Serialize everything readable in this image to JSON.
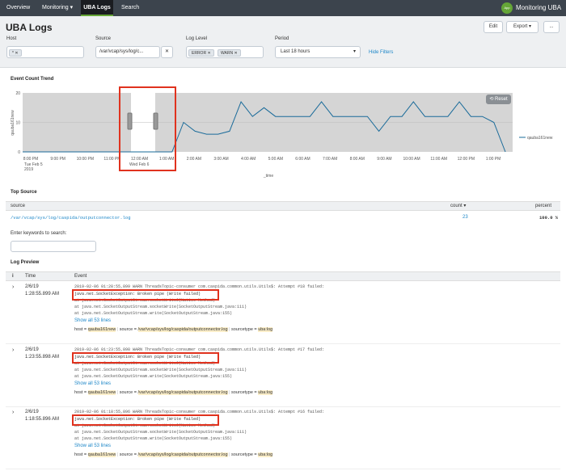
{
  "nav": {
    "tabs": [
      "Overview",
      "Monitoring ▾",
      "UBA Logs",
      "Search"
    ],
    "app_logo_text": "App",
    "app_title": "Monitoring UBA"
  },
  "page": {
    "title": "UBA Logs",
    "buttons": {
      "edit": "Edit",
      "export": "Export ▾",
      "more": "..."
    }
  },
  "filters": {
    "host": {
      "label": "Host",
      "token": "*"
    },
    "source": {
      "label": "Source",
      "value": "/var/vcap/sys/log/c..."
    },
    "loglevel": {
      "label": "Log Level",
      "tokens": [
        "ERROR",
        "WARN"
      ]
    },
    "period": {
      "label": "Period",
      "value": "Last 18 hours"
    },
    "hide_filters": "Hide Filters"
  },
  "trend": {
    "title": "Event Count Trend",
    "reset_label": "⟲ Reset",
    "legend": "qauba161new",
    "ylabel": "qauba161new",
    "xlabel": "_time",
    "date_labels": {
      "left": "Tue Feb 5",
      "left_year": "2019",
      "mid": "Wed Feb 6"
    }
  },
  "chart_data": {
    "type": "line",
    "series": [
      {
        "name": "qauba161new",
        "values": [
          0,
          0,
          0,
          0,
          0,
          0,
          0,
          0,
          0,
          0,
          0,
          0,
          0,
          0,
          10,
          7,
          6,
          6,
          7,
          17,
          12,
          15,
          12,
          12,
          12,
          12,
          17,
          12,
          12,
          12,
          12,
          7,
          12,
          12,
          17,
          12,
          12,
          12,
          17,
          12,
          12,
          10,
          0
        ]
      }
    ],
    "x_ticks": [
      "8:00 PM",
      "9:00 PM",
      "10:00 PM",
      "11:00 PM",
      "12:00 AM",
      "1:00 AM",
      "2:00 AM",
      "3:00 AM",
      "4:00 AM",
      "5:00 AM",
      "6:00 AM",
      "7:00 AM",
      "8:00 AM",
      "9:00 AM",
      "10:00 AM",
      "11:00 AM",
      "12:00 PM",
      "1:00 PM"
    ],
    "y_ticks": [
      "20",
      "10",
      "0"
    ],
    "ylim": [
      0,
      20
    ],
    "xlabel": "_time",
    "ylabel": "qauba161new",
    "grid": true,
    "legend_position": "right"
  },
  "top_source": {
    "title": "Top Source",
    "columns": {
      "source": "source",
      "count": "count",
      "percent": "percent"
    },
    "row": {
      "source": "/var/vcap/sys/log/caspida/outputconnector.log",
      "count": "23",
      "percent": "100.0 %"
    }
  },
  "keywords": {
    "label": "Enter keywords to search:"
  },
  "log_preview": {
    "title": "Log Preview",
    "columns": {
      "info": "i",
      "time": "Time",
      "event": "Event"
    },
    "events": [
      {
        "date": "2/6/19",
        "time": "1:28:55.899 AM",
        "line1": "2019-02-06 01:28:55,899 WARN ThreadsTopic-consumer com.caspida.common.utils.Utils$: Attempt #18 failed:",
        "exception": "java.net.SocketException: Broken pipe (Write failed)",
        "stack": [
          "        at java.net.SocketOutputStream.socketWrite0(Native Method)",
          "        at java.net.SocketOutputStream.socketWrite(SocketOutputStream.java:111)",
          "        at java.net.SocketOutputStream.write(SocketOutputStream.java:155)"
        ],
        "show_all": "Show all 53 lines",
        "host": "qauba161new",
        "source": "/var/vcap/sys/log/caspida/outputconnector.log",
        "sourcetype": "uba:log"
      },
      {
        "date": "2/6/19",
        "time": "1:23:55.898 AM",
        "line1": "2019-02-06 01:23:55,898 WARN ThreadsTopic-consumer com.caspida.common.utils.Utils$: Attempt #17 failed:",
        "exception": "java.net.SocketException: Broken pipe (Write failed)",
        "stack": [
          "        at java.net.SocketOutputStream.socketWrite0(Native Method)",
          "        at java.net.SocketOutputStream.socketWrite(SocketOutputStream.java:111)",
          "        at java.net.SocketOutputStream.write(SocketOutputStream.java:155)"
        ],
        "show_all": "Show all 53 lines",
        "host": "qauba161new",
        "source": "/var/vcap/sys/log/caspida/outputconnector.log",
        "sourcetype": "uba:log"
      },
      {
        "date": "2/6/19",
        "time": "1:18:55.896 AM",
        "line1": "2019-02-06 01:18:55,896 WARN ThreadsTopic-consumer com.caspida.common.utils.Utils$: Attempt #16 failed:",
        "exception": "java.net.SocketException: Broken pipe (Write failed)",
        "stack": [
          "        at java.net.SocketOutputStream.socketWrite0(Native Method)",
          "        at java.net.SocketOutputStream.socketWrite(SocketOutputStream.java:111)",
          "        at java.net.SocketOutputStream.write(SocketOutputStream.java:155)"
        ],
        "show_all": "Show all 53 lines",
        "host": "qauba161new",
        "source": "/var/vcap/sys/log/caspida/outputconnector.log",
        "sourcetype": "uba:log"
      }
    ],
    "meta_labels": {
      "host": "host =",
      "source": "source =",
      "sourcetype": "sourcetype ="
    }
  },
  "colors": {
    "accent_green": "#65a637",
    "highlight_red": "#e0321e",
    "link": "#1e87c8",
    "line": "#1a6b9a"
  }
}
